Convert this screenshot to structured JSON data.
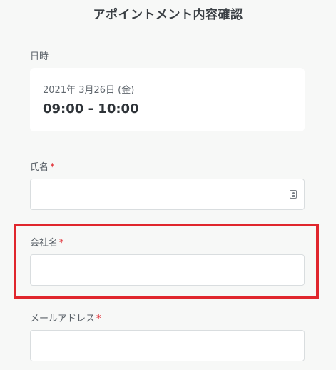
{
  "page": {
    "title": "アポイントメント内容確認"
  },
  "datetime": {
    "label": "日時",
    "date": "2021年 3月26日 (金)",
    "time": "09:00 - 10:00"
  },
  "form": {
    "required_mark": "*",
    "name": {
      "label": "氏名",
      "value": "",
      "icon": "contact-card-icon"
    },
    "company": {
      "label": "会社名",
      "value": ""
    },
    "email": {
      "label": "メールアドレス",
      "value": ""
    }
  },
  "annotation": {
    "highlight_color": "#e0262d"
  },
  "colors": {
    "background": "#f7f8f7",
    "card": "#ffffff",
    "required": "#e0262d",
    "text": "#3a3f44"
  }
}
